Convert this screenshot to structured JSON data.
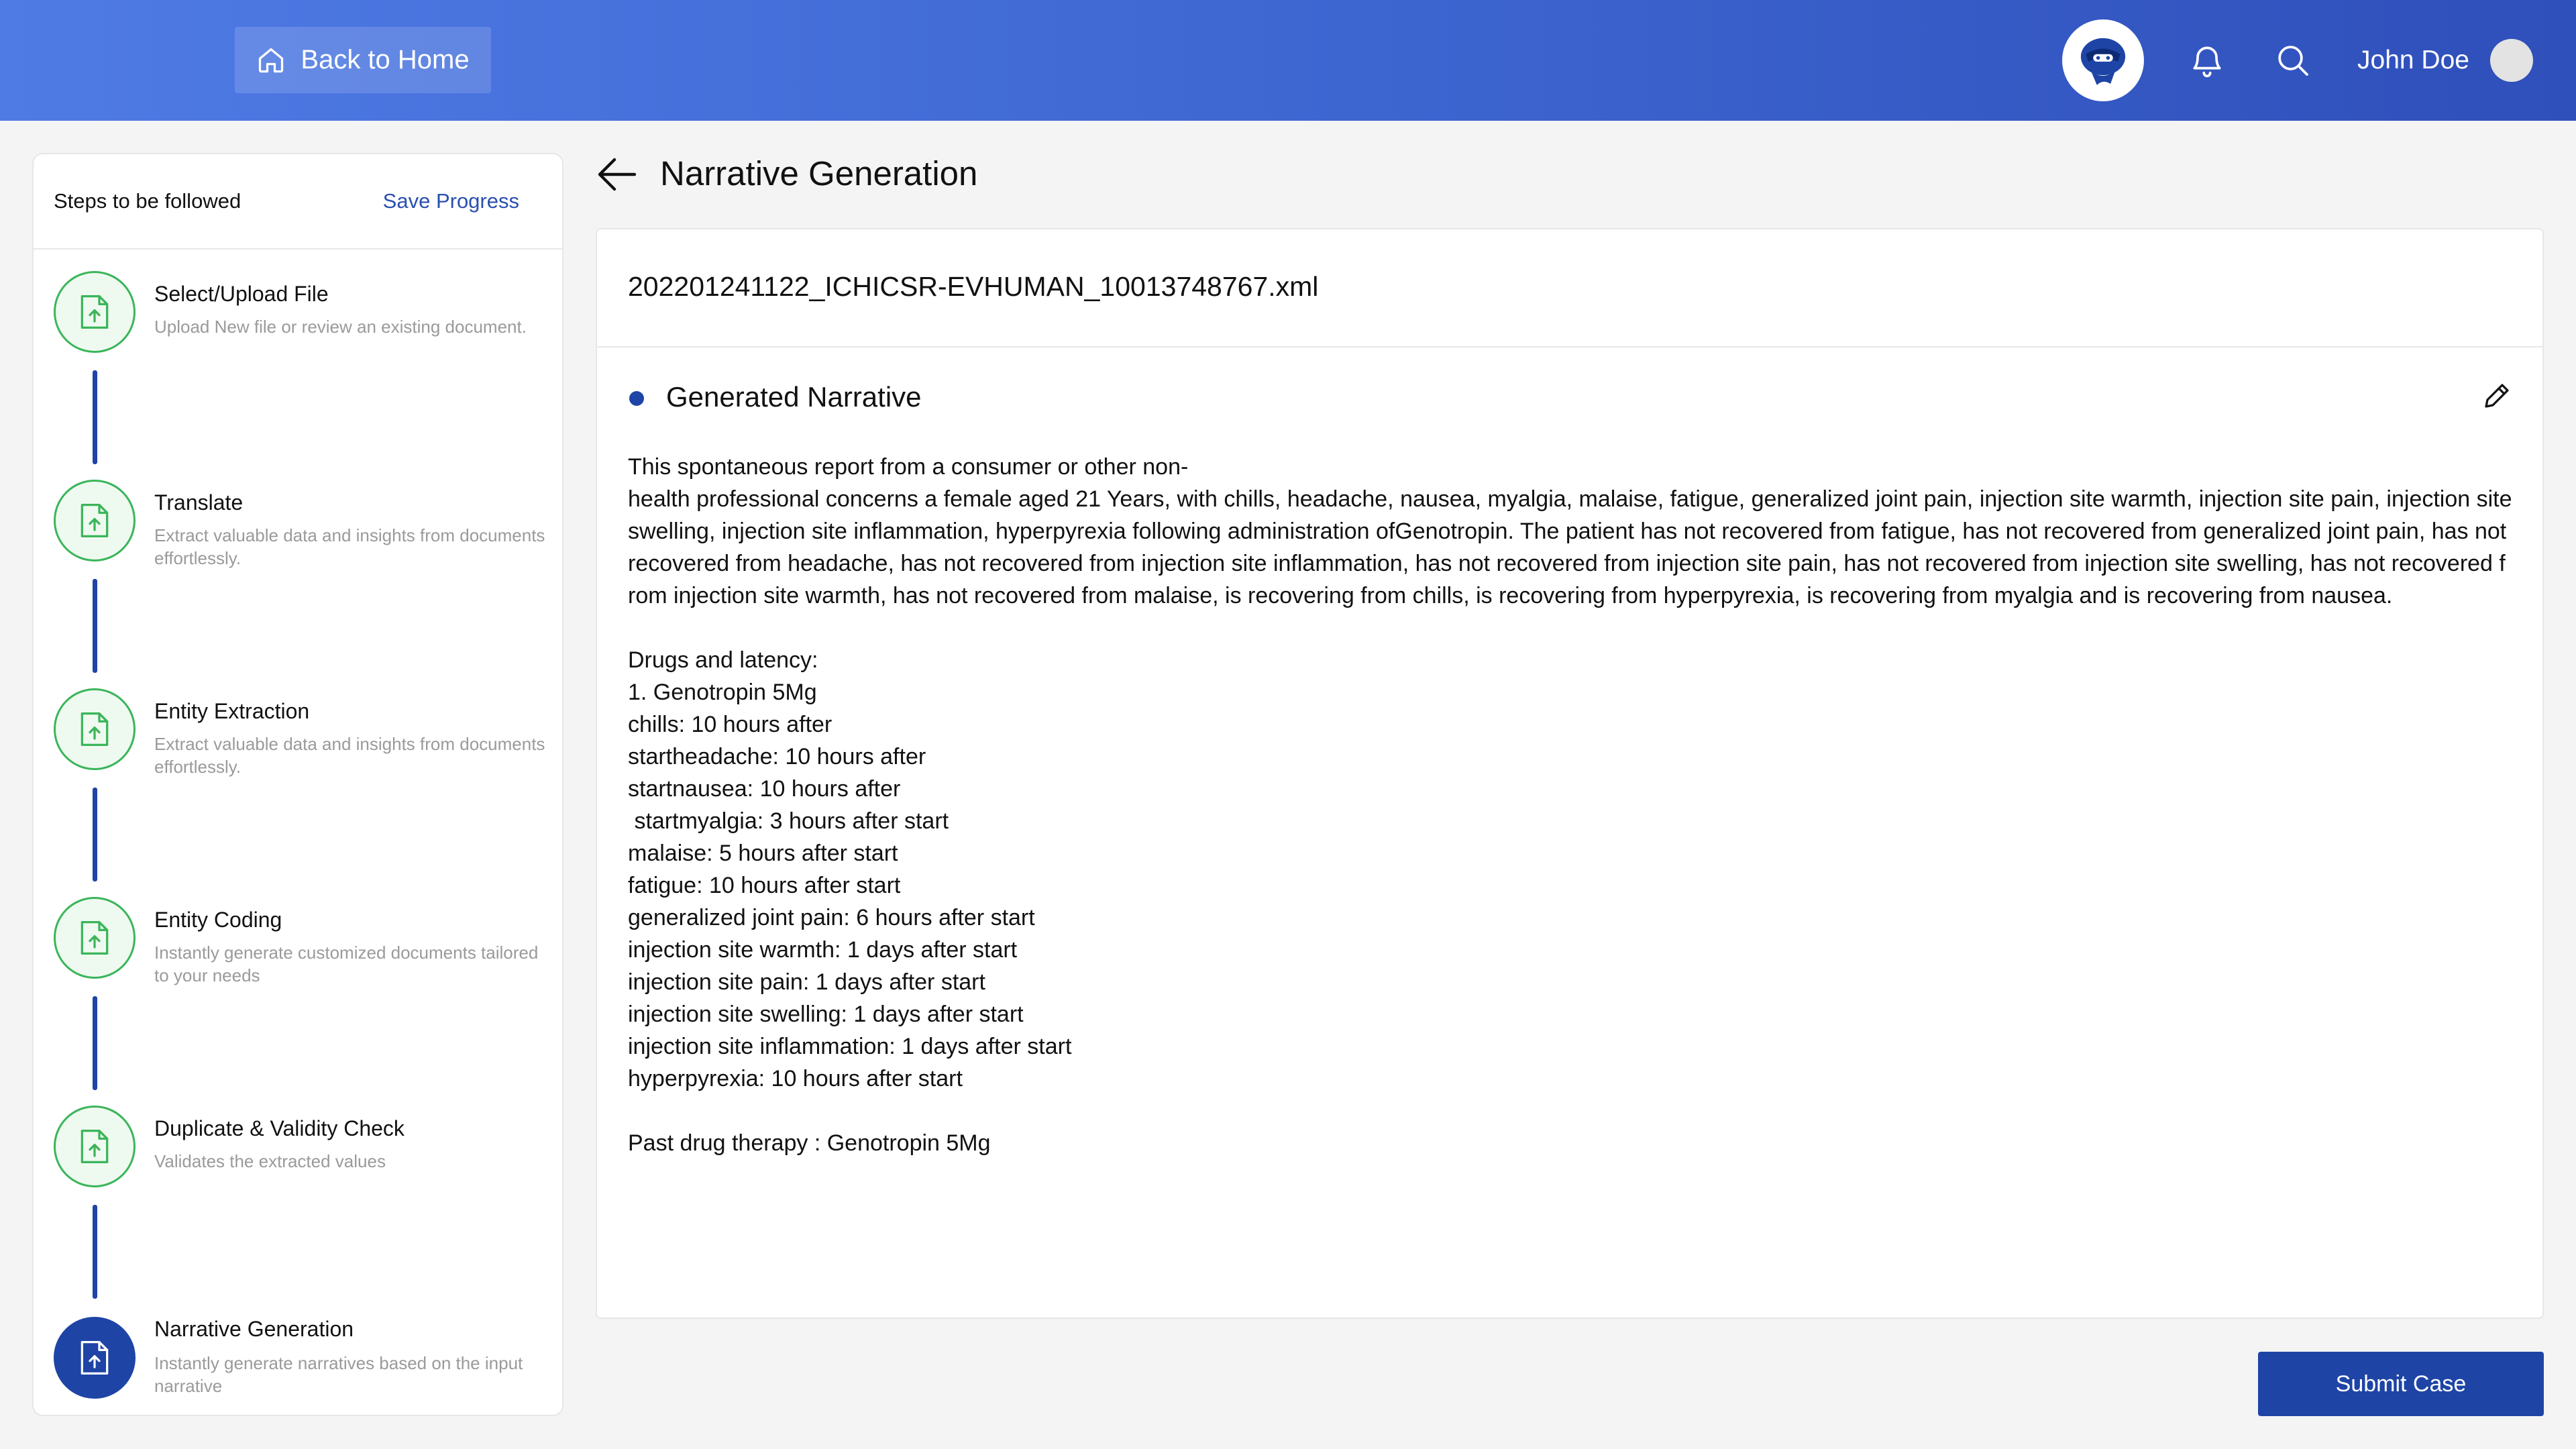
{
  "header": {
    "back_home_label": "Back to Home",
    "user_name": "John Doe"
  },
  "steps_panel": {
    "title": "Steps to be followed",
    "save_label": "Save Progress",
    "steps": [
      {
        "title": "Select/Upload File",
        "desc": "Upload New file or review an existing document.",
        "status": "completed"
      },
      {
        "title": "Translate",
        "desc": "Extract valuable data and insights from documents effortlessly.",
        "status": "completed"
      },
      {
        "title": "Entity Extraction",
        "desc": "Extract valuable data and insights from documents effortlessly.",
        "status": "completed"
      },
      {
        "title": "Entity Coding",
        "desc": "Instantly generate customized documents tailored to your needs",
        "status": "completed"
      },
      {
        "title": "Duplicate & Validity Check",
        "desc": "Validates the extracted values",
        "status": "completed"
      },
      {
        "title": "Narrative Generation",
        "desc": "Instantly generate narratives based on the input narrative",
        "status": "active"
      }
    ]
  },
  "main": {
    "page_title": "Narrative Generation",
    "file_name": "202201241122_ICHICSR-EVHUMAN_10013748767.xml",
    "section_title": "Generated Narrative",
    "narrative": "This spontaneous report from a consumer or other non-\nhealth professional concerns a female aged 21 Years, with chills, headache, nausea, myalgia, malaise, fatigue, generalized joint pain, injection site warmth, injection site pain, injection site swelling, injection site inflammation, hyperpyrexia following administration ofGenotropin. The patient has not recovered from fatigue, has not recovered from generalized joint pain, has not recovered from headache, has not recovered from injection site inflammation, has not recovered from injection site pain, has not recovered from injection site swelling, has not recovered from injection site warmth, has not recovered from malaise, is recovering from chills, is recovering from hyperpyrexia, is recovering from myalgia and is recovering from nausea.\n\nDrugs and latency:\n1. Genotropin 5Mg\nchills: 10 hours after\nstartheadache: 10 hours after\nstartnausea: 10 hours after\n startmyalgia: 3 hours after start\nmalaise: 5 hours after start\nfatigue: 10 hours after start\ngeneralized joint pain: 6 hours after start\ninjection site warmth: 1 days after start\ninjection site pain: 1 days after start\ninjection site swelling: 1 days after start\ninjection site inflammation: 1 days after start\nhyperpyrexia: 10 hours after start\n\nPast drug therapy : Genotropin 5Mg",
    "submit_label": "Submit Case"
  },
  "colors": {
    "header_gradient_start": "#4f7be5",
    "header_gradient_end": "#2f4fba",
    "accent": "#1e44a6",
    "step_done": "#3bb55a"
  },
  "icons": [
    "home-icon",
    "logo-icon",
    "bell-icon",
    "search-icon",
    "file-upload-icon",
    "back-arrow-icon",
    "pencil-icon"
  ]
}
